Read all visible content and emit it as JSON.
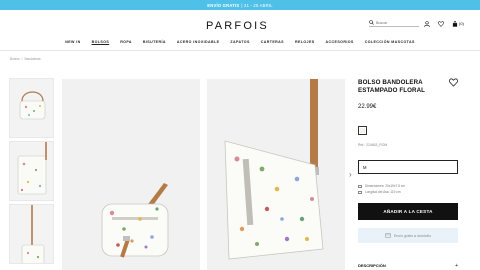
{
  "promo": {
    "bold": "ENVÍO GRATIS",
    "text": "| 21 - 25 ABRIL"
  },
  "header": {
    "logo": "PARFOIS",
    "search_placeholder": "Buscar",
    "cart_count": "(0)",
    "icons": [
      "search-icon",
      "user-icon",
      "heart-icon",
      "bag-icon"
    ]
  },
  "nav": {
    "items": [
      {
        "label": "NEW IN"
      },
      {
        "label": "BOLSOS"
      },
      {
        "label": "ROPA"
      },
      {
        "label": "BISUTERÍA"
      },
      {
        "label": "ACERO INOXIDABLE"
      },
      {
        "label": "ZAPATOS"
      },
      {
        "label": "CARTERAS"
      },
      {
        "label": "RELOJES"
      },
      {
        "label": "ACCESORIOS"
      },
      {
        "label": "COLECCIÓN MASCOTAS"
      }
    ],
    "active_index": 1
  },
  "breadcrumb": {
    "items": [
      "Bolsos",
      "/",
      "Bandoleras"
    ]
  },
  "product": {
    "title": "BOLSO BANDOLERA ESTAMPADO FLORAL",
    "price": "22.99€",
    "reference": "Ref.: 224663_ROM",
    "size": "M",
    "dimension_1": "Dimensiones: 20x19x7.5 cm",
    "dimension_2": "Longitud del Asa: 119 cm",
    "add_to_cart": "AÑADIR A LA CESTA",
    "shipping": "Envío gratis a domicilio",
    "description": "DESCRIPCIÓN",
    "description_toggle": "+"
  },
  "colors": {
    "promo_bar": "#4fc0e8",
    "button": "#111111",
    "shipping_bg": "#e8f2f8"
  }
}
